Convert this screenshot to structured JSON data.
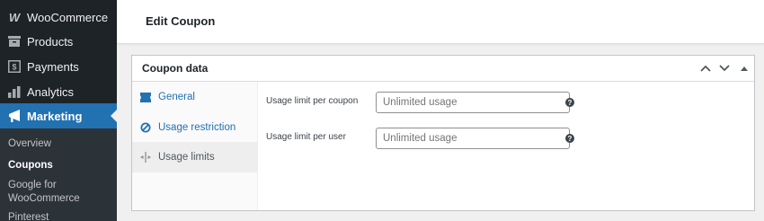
{
  "sidebar": {
    "items": [
      {
        "label": "WooCommerce",
        "icon": "woocommerce-icon"
      },
      {
        "label": "Products",
        "icon": "products-icon"
      },
      {
        "label": "Payments",
        "icon": "payments-icon"
      },
      {
        "label": "Analytics",
        "icon": "analytics-icon"
      },
      {
        "label": "Marketing",
        "icon": "marketing-icon",
        "active": true
      }
    ],
    "submenu": [
      "Overview",
      "Coupons",
      "Google for WooCommerce",
      "Pinterest"
    ],
    "current_submenu": "Coupons"
  },
  "topbar": {
    "title": "Edit Coupon"
  },
  "panel": {
    "title": "Coupon data",
    "tabs": [
      {
        "label": "General",
        "icon": "ticket-icon"
      },
      {
        "label": "Usage restriction",
        "icon": "restriction-icon"
      },
      {
        "label": "Usage limits",
        "icon": "limits-icon",
        "active": true
      }
    ],
    "fields": [
      {
        "label": "Usage limit per coupon",
        "placeholder": "Unlimited usage",
        "value": ""
      },
      {
        "label": "Usage limit per user",
        "placeholder": "Unlimited usage",
        "value": ""
      }
    ],
    "help_glyph": "?"
  },
  "colors": {
    "sidebar_bg": "#1d2327",
    "accent": "#2271b1",
    "submenu_bg": "#2c3338"
  }
}
